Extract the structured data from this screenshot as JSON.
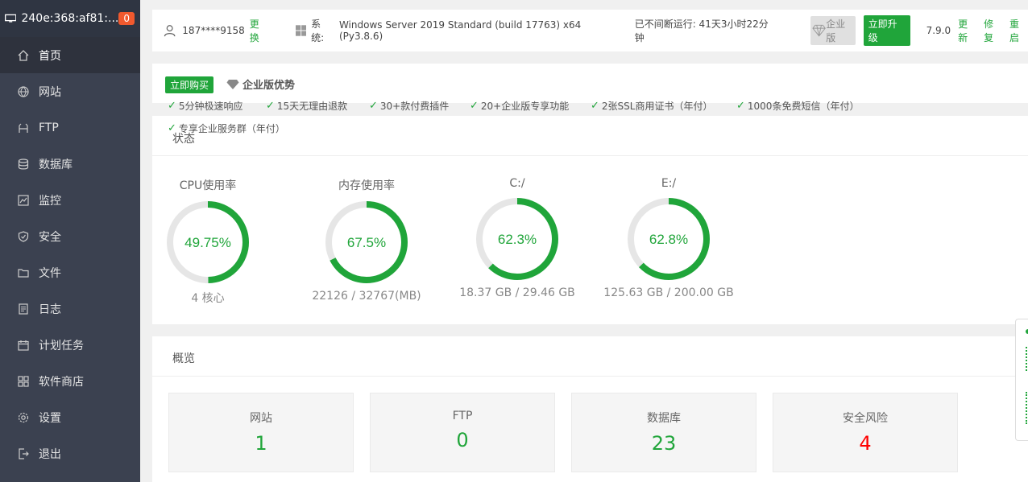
{
  "sidebar": {
    "server_name": "240e:368:af81:...",
    "badge": "0",
    "items": [
      {
        "label": "首页",
        "icon": "home-icon"
      },
      {
        "label": "网站",
        "icon": "globe-icon"
      },
      {
        "label": "FTP",
        "icon": "ftp-icon"
      },
      {
        "label": "数据库",
        "icon": "database-icon"
      },
      {
        "label": "监控",
        "icon": "monitor-chart-icon"
      },
      {
        "label": "安全",
        "icon": "shield-icon"
      },
      {
        "label": "文件",
        "icon": "folder-icon"
      },
      {
        "label": "日志",
        "icon": "log-icon"
      },
      {
        "label": "计划任务",
        "icon": "calendar-icon"
      },
      {
        "label": "软件商店",
        "icon": "grid-icon"
      },
      {
        "label": "设置",
        "icon": "gear-icon"
      },
      {
        "label": "退出",
        "icon": "logout-icon"
      }
    ]
  },
  "topbar": {
    "phone": "187****9158",
    "change_label": "更换",
    "sys_label": "系统:",
    "os": "Windows Server 2019 Standard (build 17763) x64 (Py3.8.6)",
    "uptime": "已不间断运行: 41天3小时22分钟",
    "enterprise_label": "企业版",
    "upgrade_label": "立即升级",
    "version": "7.9.0",
    "update_label": "更新",
    "repair_label": "修复",
    "restart_label": "重启"
  },
  "promo": {
    "buy_label": "立即购买",
    "advantage_label": "企业版优势",
    "features": [
      "5分钟极速响应",
      "15天无理由退款",
      "30+款付费插件",
      "20+企业版专享功能",
      "2张SSL商用证书（年付）",
      "1000条免费短信（年付）",
      "专享企业服务群（年付）"
    ]
  },
  "status": {
    "title": "状态",
    "gauges": [
      {
        "label": "CPU使用率",
        "value": "49.75%",
        "fraction": 0.4975,
        "sub": "4 核心"
      },
      {
        "label": "内存使用率",
        "value": "67.5%",
        "fraction": 0.675,
        "sub": "22126 / 32767(MB)"
      },
      {
        "label": "C:/",
        "value": "62.3%",
        "fraction": 0.623,
        "sub": "18.37 GB / 29.46 GB"
      },
      {
        "label": "E:/",
        "value": "62.8%",
        "fraction": 0.628,
        "sub": "125.63 GB / 200.00 GB"
      }
    ]
  },
  "overview": {
    "title": "概览",
    "cards": [
      {
        "label": "网站",
        "value": "1"
      },
      {
        "label": "FTP",
        "value": "0"
      },
      {
        "label": "数据库",
        "value": "23"
      },
      {
        "label": "安全风险",
        "value": "4"
      }
    ]
  },
  "colors": {
    "accent": "#20a53a",
    "danger": "#ff0000",
    "sidebar_bg": "#3b4150"
  }
}
